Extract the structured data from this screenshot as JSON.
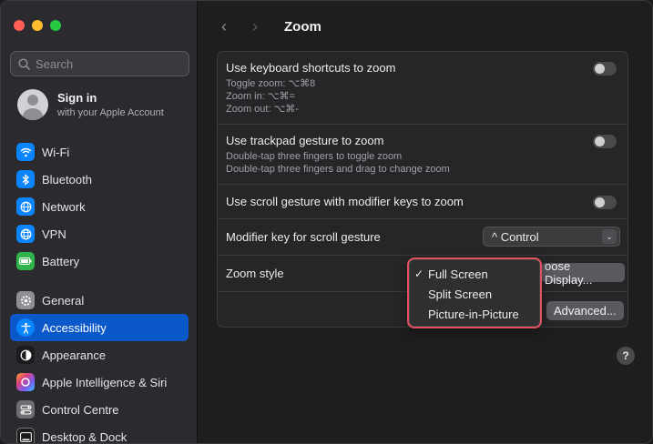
{
  "search": {
    "placeholder": "Search"
  },
  "account": {
    "title": "Sign in",
    "subtitle": "with your Apple Account"
  },
  "sidebar": {
    "group1": [
      {
        "label": "Wi-Fi",
        "icon": "wifi-icon",
        "color": "#0a84ff"
      },
      {
        "label": "Bluetooth",
        "icon": "bluetooth-icon",
        "color": "#0a84ff"
      },
      {
        "label": "Network",
        "icon": "globe-icon",
        "color": "#0a84ff"
      },
      {
        "label": "VPN",
        "icon": "vpn-icon",
        "color": "#0a84ff"
      },
      {
        "label": "Battery",
        "icon": "battery-icon",
        "color": "#30b34a"
      }
    ],
    "group2": [
      {
        "label": "General",
        "icon": "gear-icon",
        "color": "#8e8e93"
      },
      {
        "label": "Accessibility",
        "icon": "accessibility-icon",
        "color": "#0a84ff",
        "active": true
      },
      {
        "label": "Appearance",
        "icon": "appearance-icon",
        "color": "#1c1c1e"
      },
      {
        "label": "Apple Intelligence & Siri",
        "icon": "siri-icon",
        "color": "#b44fe0"
      },
      {
        "label": "Control Centre",
        "icon": "control-centre-icon",
        "color": "#6e6e73"
      },
      {
        "label": "Desktop & Dock",
        "icon": "dock-icon",
        "color": "#1c1c1e"
      }
    ]
  },
  "header": {
    "title": "Zoom"
  },
  "settings": {
    "keyboard": {
      "title": "Use keyboard shortcuts to zoom",
      "lines": [
        "Toggle zoom: ⌥⌘8",
        "Zoom in: ⌥⌘=",
        "Zoom out: ⌥⌘-"
      ]
    },
    "trackpad": {
      "title": "Use trackpad gesture to zoom",
      "lines": [
        "Double-tap three fingers to toggle zoom",
        "Double-tap three fingers and drag to change zoom"
      ]
    },
    "scroll": {
      "title": "Use scroll gesture with modifier keys to zoom"
    },
    "modifier": {
      "title": "Modifier key for scroll gesture",
      "value": "^ Control"
    },
    "zoom_style": {
      "title": "Zoom style",
      "choose_button": "oose Display...",
      "advanced_button": "Advanced..."
    }
  },
  "zoom_menu": {
    "options": [
      "Full Screen",
      "Split Screen",
      "Picture-in-Picture"
    ],
    "selected": "Full Screen"
  },
  "help_label": "?"
}
